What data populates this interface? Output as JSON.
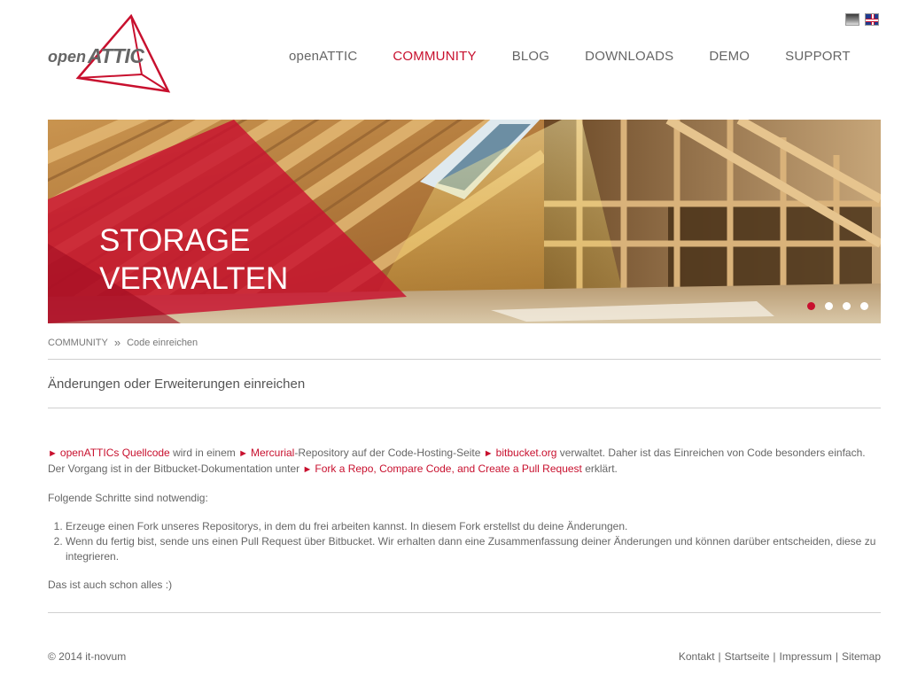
{
  "logo": {
    "text_open": "open",
    "text_attic": "ATTIC"
  },
  "nav": {
    "items": [
      {
        "label": "openATTIC"
      },
      {
        "label": "COMMUNITY"
      },
      {
        "label": "BLOG"
      },
      {
        "label": "DOWNLOADS"
      },
      {
        "label": "DEMO"
      },
      {
        "label": "SUPPORT"
      }
    ]
  },
  "hero": {
    "line1": "STORAGE",
    "line2": "VERWALTEN"
  },
  "breadcrumb": {
    "parent": "COMMUNITY",
    "separator": "»",
    "current": "Code einreichen"
  },
  "page_title": "Änderungen oder Erweiterungen einreichen",
  "content": {
    "p1": {
      "link1": "openATTICs Quellcode",
      "t1": " wird in einem ",
      "link2": "Mercurial",
      "t2": "-Repository auf der Code-Hosting-Seite ",
      "link3": "bitbucket.org",
      "t3": " verwaltet. Daher ist das Einreichen von Code besonders einfach. Der Vorgang ist in der Bitbucket-Dokumentation unter ",
      "link4": "Fork a Repo, Compare Code, and Create a Pull Request",
      "t4": " erklärt."
    },
    "p2": "Folgende Schritte sind notwendig:",
    "steps": [
      "Erzeuge einen Fork unseres Repositorys, in dem du frei arbeiten kannst. In diesem Fork erstellst du deine Änderungen.",
      "Wenn du fertig bist, sende uns einen Pull Request über Bitbucket. Wir erhalten dann eine Zusammenfassung deiner Änderungen und können darüber entscheiden, diese zu integrieren."
    ],
    "p3": "Das ist auch schon alles :)"
  },
  "footer": {
    "copyright": "© 2014 it-novum",
    "links": [
      "Kontakt",
      "Startseite",
      "Impressum",
      "Sitemap"
    ]
  },
  "colors": {
    "accent": "#c8102e",
    "text": "#666666"
  }
}
